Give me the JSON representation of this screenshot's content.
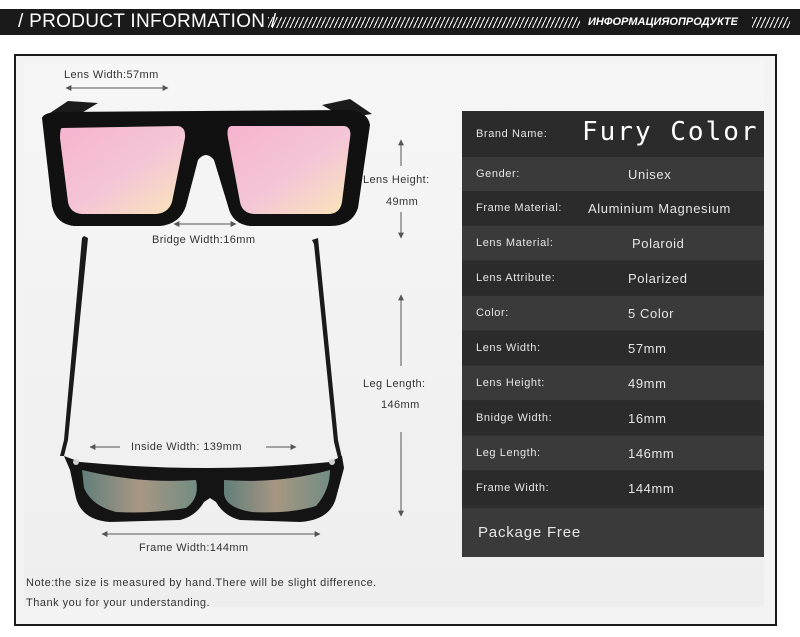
{
  "header": {
    "title": "/ PRODUCT INFORMATION /",
    "subtitle_ru": "ИНФОРМАЦИЯОПРОДУКТЕ"
  },
  "dimensions": {
    "lens_width": "Lens Width:57mm",
    "bridge_width": "Bridge Width:16mm",
    "lens_height_label": "Lens Height:",
    "lens_height_value": "49mm",
    "leg_length_label": "Leg Length:",
    "leg_length_value": "146mm",
    "inside_width": "Inside Width: 139mm",
    "frame_width": "Frame Width:144mm"
  },
  "specs": {
    "brand_label": "Brand Name:",
    "brand_value": "Fury Color",
    "rows": [
      {
        "label": "Gender:",
        "value": "Unisex"
      },
      {
        "label": "Frame Material:",
        "value": "Aluminium Magnesium"
      },
      {
        "label": "Lens Material:",
        "value": "Polaroid"
      },
      {
        "label": "Lens Attribute:",
        "value": "Polarized"
      },
      {
        "label": "Color:",
        "value": "5 Color"
      },
      {
        "label": "Lens Width:",
        "value": "57mm"
      },
      {
        "label": "Lens Height:",
        "value": "49mm"
      },
      {
        "label": "Bnidge Width:",
        "value": "16mm"
      },
      {
        "label": "Leg Length:",
        "value": "146mm"
      },
      {
        "label": "Frame Width:",
        "value": "144mm"
      }
    ],
    "package": "Package Free"
  },
  "notes": {
    "line1": "Note:the size is measured by hand.There will be slight difference.",
    "line2": "Thank you for your understanding."
  },
  "colors": {
    "banner": "#1a1a1a",
    "panel_dark": "#2b2b2b",
    "panel_light": "#3a3a3a",
    "lens_pink": "#f3a9c6",
    "frame_black": "#111111"
  }
}
